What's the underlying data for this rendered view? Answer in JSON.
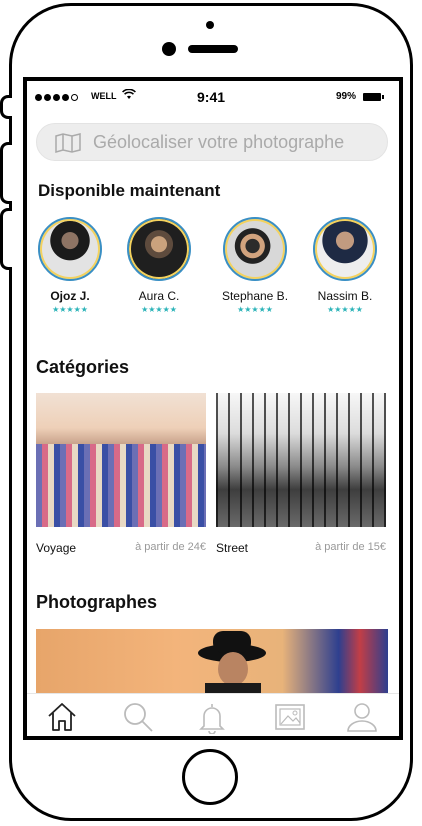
{
  "status_bar": {
    "carrier": "WELL",
    "time": "9:41",
    "battery": "99%"
  },
  "search": {
    "placeholder": "Géolocaliser votre photographe",
    "icon": "map-icon"
  },
  "available": {
    "title": "Disponible maintenant",
    "photographers": [
      {
        "name": "Ojoz J.",
        "rating": "★★★★★"
      },
      {
        "name": "Aura C.",
        "rating": "★★★★★"
      },
      {
        "name": "Stephane B.",
        "rating": "★★★★★"
      },
      {
        "name": "Nassim B.",
        "rating": "★★★★★"
      }
    ]
  },
  "categories": {
    "title": "Catégories",
    "items": [
      {
        "label": "Voyage",
        "price": "à partir de 24€"
      },
      {
        "label": "Street",
        "price": "à partir de 15€"
      }
    ]
  },
  "photographers_section": {
    "title": "Photographes"
  },
  "tabbar": {
    "icons": [
      "home-icon",
      "search-icon",
      "bell-icon",
      "gallery-icon",
      "profile-icon"
    ]
  },
  "colors": {
    "accent": "#2bb3b8",
    "avatar_ring": "#3a8fc4"
  }
}
